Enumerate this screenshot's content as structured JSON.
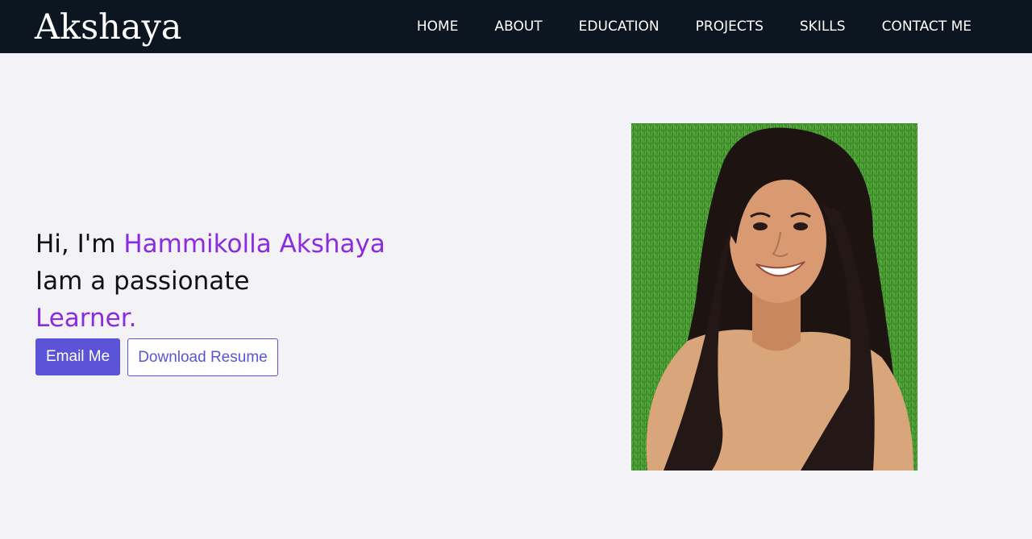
{
  "nav": {
    "brand": "Akshaya",
    "links": [
      {
        "label": "HOME"
      },
      {
        "label": "ABOUT"
      },
      {
        "label": "EDUCATION"
      },
      {
        "label": "PROJECTS"
      },
      {
        "label": "SKILLS"
      },
      {
        "label": "CONTACT ME"
      }
    ]
  },
  "hero": {
    "greeting": "Hi, I'm ",
    "name": "Hammikolla Akshaya",
    "line2": "Iam a passionate",
    "role": "Learner.",
    "email_button": "Email Me",
    "resume_button": "Download Resume"
  },
  "colors": {
    "navbar_bg": "#0b1620",
    "page_bg": "#f3f2f7",
    "accent_purple": "#8a2be2",
    "button_blue": "#5c54d8"
  }
}
